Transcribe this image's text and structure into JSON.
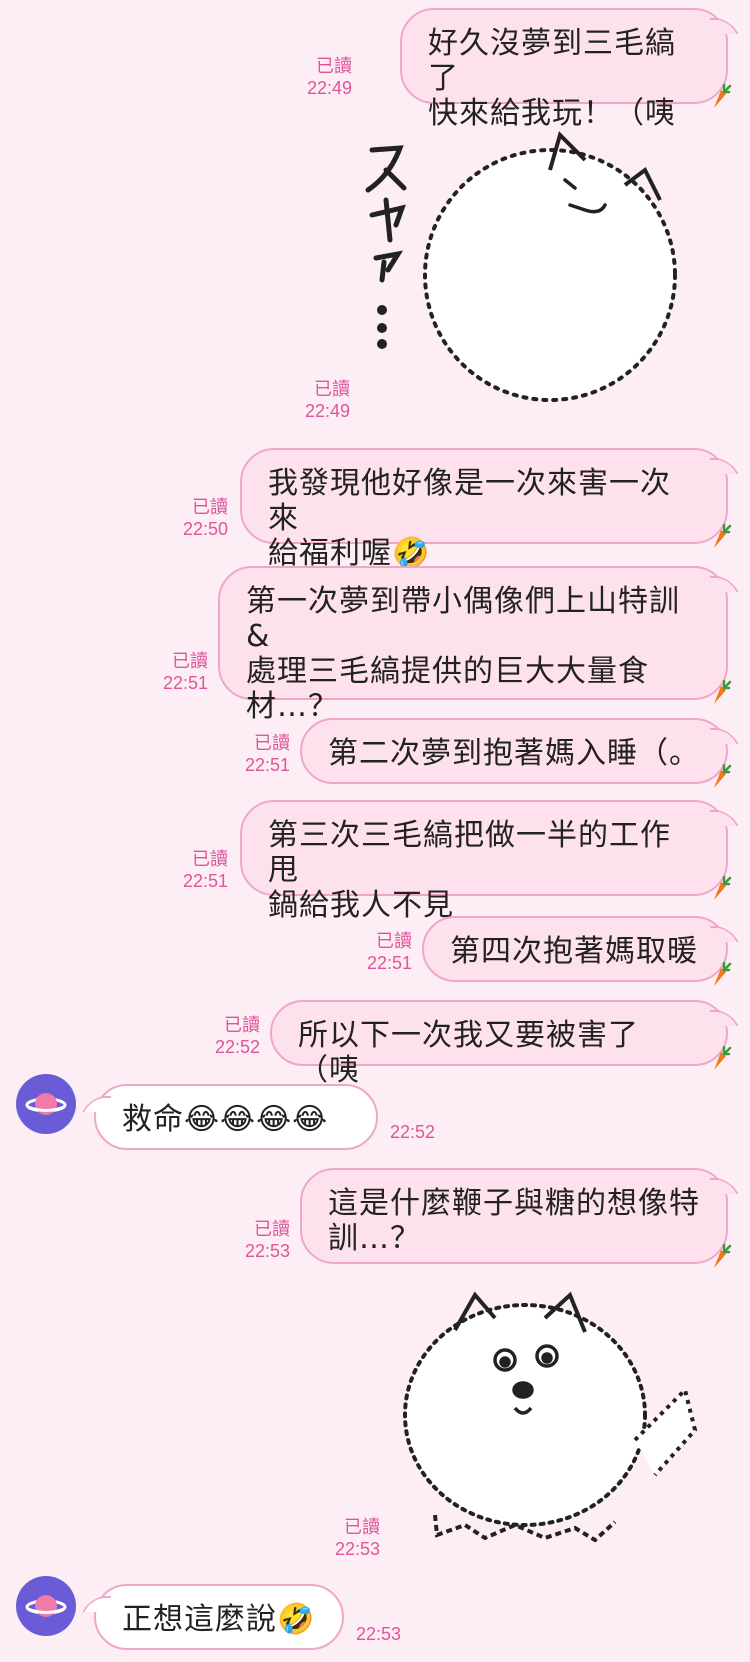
{
  "read_label": "已讀",
  "messages": [
    {
      "text_lines": [
        "好久沒夢到三毛縞了",
        "快來給我玩！（咦"
      ],
      "time": "22:49"
    },
    {
      "sticker": "sleeping-fluffy-dog-sticker",
      "sticker_text": "スヤァ…",
      "time": "22:49"
    },
    {
      "text_lines": [
        "我發現他好像是一次來害一次來",
        "給福利喔🤣"
      ],
      "time": "22:50"
    },
    {
      "text_lines": [
        "第一次夢到帶小偶像們上山特訓&",
        "處理三毛縞提供的巨大大量食",
        "材…？"
      ],
      "time": "22:51"
    },
    {
      "text_lines": [
        "第二次夢到抱著媽入睡（。"
      ],
      "time": "22:51"
    },
    {
      "text_lines": [
        "第三次三毛縞把做一半的工作甩",
        "鍋給我人不見"
      ],
      "time": "22:51"
    },
    {
      "text_lines": [
        "第四次抱著媽取暖"
      ],
      "time": "22:51"
    },
    {
      "text_lines": [
        "所以下一次我又要被害了（咦"
      ],
      "time": "22:52"
    },
    {
      "incoming": true,
      "text": "救命😂😂😂😂",
      "time": "22:52"
    },
    {
      "text_lines": [
        "這是什麼鞭子與糖的想像特",
        "訓…？"
      ],
      "time": "22:53"
    },
    {
      "sticker": "surprised-fluffy-dog-sticker",
      "time": "22:53"
    },
    {
      "incoming": true,
      "text": "正想這麼說🤣",
      "time": "22:53"
    }
  ],
  "colors": {
    "background": "#fdeef5",
    "bubble": "#fde2ee",
    "border": "#f0a7c6",
    "accent": "#e0549b",
    "avatar": "#6a5cd6"
  }
}
